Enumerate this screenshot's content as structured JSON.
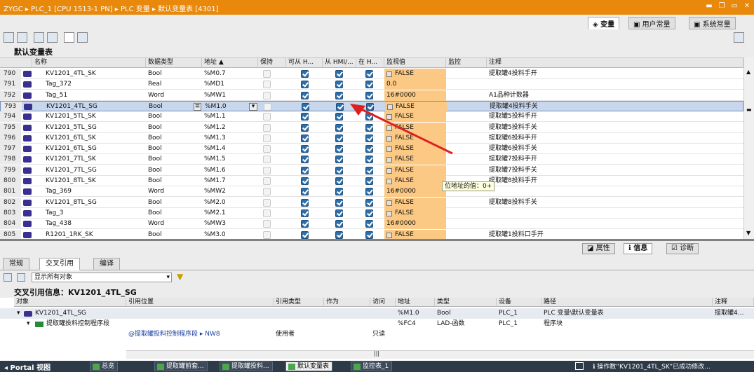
{
  "titlebar": {
    "breadcrumb": "ZYGC  ▸  PLC_1 [CPU 1513-1 PN]  ▸  PLC 变量  ▸  默认变量表 [4301]"
  },
  "top_tabs": {
    "variables": "变量",
    "user_constants": "用户常量",
    "system_constants": "系统常量"
  },
  "table_title": "默认变量表",
  "columns": {
    "name": "名称",
    "datatype": "数据类型",
    "address": "地址",
    "retain": "保持",
    "from_hmi": "可从 H...",
    "hmi_visible": "从 HMI/...",
    "in_hmi": "在 H...",
    "monitor_value": "监视值",
    "monitor": "监控",
    "comment": "注释"
  },
  "rows": [
    {
      "num": "790",
      "name": "KV1201_4TL_SK",
      "type": "Bool",
      "addr": "%M0.7",
      "value": "FALSE",
      "comment": "提取罐4投料手开",
      "flag": true
    },
    {
      "num": "791",
      "name": "Tag_372",
      "type": "Real",
      "addr": "%MD1",
      "value": "0.0",
      "comment": "",
      "flag": false
    },
    {
      "num": "792",
      "name": "Tag_51",
      "type": "Word",
      "addr": "%MW1",
      "value": "16#0000",
      "comment": "A1品种计数器",
      "flag": false
    },
    {
      "num": "793",
      "name": "KV1201_4TL_SG",
      "type": "Bool",
      "addr": "%M1.0",
      "value": "FALSE",
      "comment": "提取罐4投料手关",
      "flag": true
    },
    {
      "num": "794",
      "name": "KV1201_5TL_SK",
      "type": "Bool",
      "addr": "%M1.1",
      "value": "FALSE",
      "comment": "提取罐5投料手开",
      "flag": true
    },
    {
      "num": "795",
      "name": "KV1201_5TL_SG",
      "type": "Bool",
      "addr": "%M1.2",
      "value": "FALSE",
      "comment": "提取罐5投料手关",
      "flag": true
    },
    {
      "num": "796",
      "name": "KV1201_6TL_SK",
      "type": "Bool",
      "addr": "%M1.3",
      "value": "FALSE",
      "comment": "提取罐6投料手开",
      "flag": true
    },
    {
      "num": "797",
      "name": "KV1201_6TL_SG",
      "type": "Bool",
      "addr": "%M1.4",
      "value": "FALSE",
      "comment": "提取罐6投料手关",
      "flag": true
    },
    {
      "num": "798",
      "name": "KV1201_7TL_SK",
      "type": "Bool",
      "addr": "%M1.5",
      "value": "FALSE",
      "comment": "提取罐7投料手开",
      "flag": true
    },
    {
      "num": "799",
      "name": "KV1201_7TL_SG",
      "type": "Bool",
      "addr": "%M1.6",
      "value": "FALSE",
      "comment": "提取罐7投料手关",
      "flag": true
    },
    {
      "num": "800",
      "name": "KV1201_8TL_SK",
      "type": "Bool",
      "addr": "%M1.7",
      "value": "FALSE",
      "comment": "提取罐8投料手开",
      "flag": true
    },
    {
      "num": "801",
      "name": "Tag_369",
      "type": "Word",
      "addr": "%MW2",
      "value": "16#0000",
      "comment": "",
      "flag": false
    },
    {
      "num": "802",
      "name": "KV1201_8TL_SG",
      "type": "Bool",
      "addr": "%M2.0",
      "value": "FALSE",
      "comment": "提取罐8投料手关",
      "flag": true
    },
    {
      "num": "803",
      "name": "Tag_3",
      "type": "Bool",
      "addr": "%M2.1",
      "value": "FALSE",
      "comment": "",
      "flag": true
    },
    {
      "num": "804",
      "name": "Tag_438",
      "type": "Word",
      "addr": "%MW3",
      "value": "16#0000",
      "comment": "",
      "flag": false
    },
    {
      "num": "805",
      "name": "R1201_1RK_SK",
      "type": "Bool",
      "addr": "%M3.0",
      "value": "FALSE",
      "comment": "提取罐1投料口手开",
      "flag": true
    }
  ],
  "tooltip": "位地址的值：0+",
  "inspector_tabs": {
    "properties": "属性",
    "info": "信息",
    "diagnostics": "诊断"
  },
  "sub_tabs": {
    "general": "常规",
    "cross_ref": "交叉引用",
    "compile": "编译"
  },
  "filter_value": "显示所有对象",
  "cross_title": "交叉引用信息：KV1201_4TL_SG",
  "xcolumns": {
    "object": "对象",
    "ref_loc": "引用位置",
    "ref_type": "引用类型",
    "as": "作为",
    "access": "访问",
    "addr": "地址",
    "type": "类型",
    "device": "设备",
    "path": "路径",
    "comment": "注释"
  },
  "xrows": [
    {
      "object": "KV1201_4TL_SG",
      "ref_loc": "",
      "ref_type": "",
      "access": "",
      "addr": "%M1.0",
      "type": "Bool",
      "device": "PLC_1",
      "path": "PLC 变量\\默认变量表",
      "comment": "提取罐4..."
    },
    {
      "object": "提取罐投料控制程序段",
      "ref_loc": "",
      "ref_type": "",
      "access": "",
      "addr": "%FC4",
      "type": "LAD-函数",
      "device": "PLC_1",
      "path": "程序块",
      "comment": ""
    },
    {
      "object": "",
      "ref_loc": "@提取罐投料控制程序段 ▸ NW8",
      "ref_type": "使用者",
      "access": "只读",
      "addr": "",
      "type": "",
      "device": "",
      "path": "",
      "comment": ""
    }
  ],
  "taskbar": {
    "portal": "Portal 视图",
    "items": [
      "总览",
      "提取罐前套...",
      "提取罐投料...",
      "默认变量表",
      "监控表_1"
    ],
    "status": "操作数“KV1201_4TL_SK”已成功修改..."
  }
}
